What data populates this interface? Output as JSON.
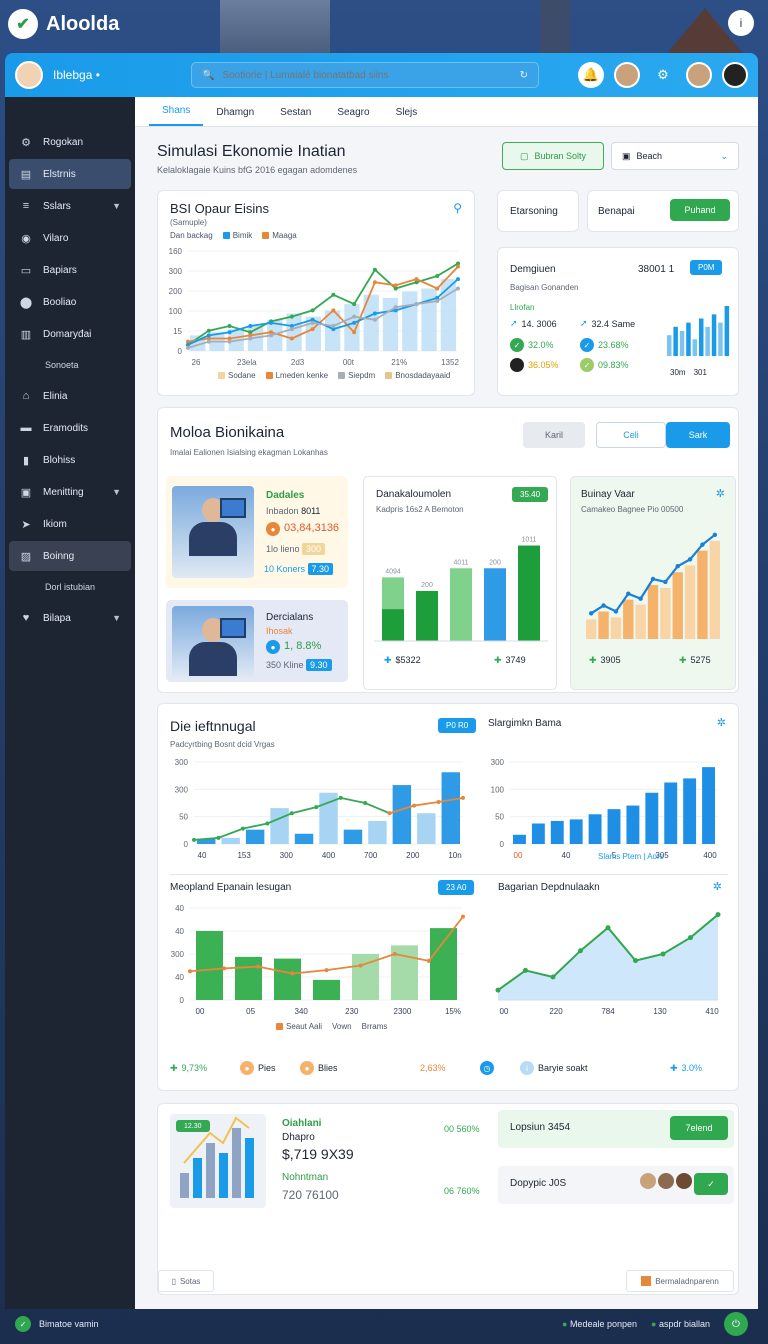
{
  "app": {
    "brand": "Aloolda",
    "help_icon": "info-icon",
    "workspace": "Iblebga"
  },
  "search": {
    "placeholder": "Sootiorie | Lumaialé bionatatbad siins"
  },
  "tabs": [
    "Shans",
    "Dhamgn",
    "Sestan",
    "Seagro",
    "Slejs"
  ],
  "sidebar": {
    "items": [
      {
        "label": "Rogokan",
        "icon": "gear-icon"
      },
      {
        "label": "Elstrnis",
        "icon": "document-icon"
      },
      {
        "label": "Sslars",
        "icon": "list-icon",
        "chevron": true
      },
      {
        "label": "Vilaro",
        "icon": "globe-icon"
      },
      {
        "label": "Bapiars",
        "icon": "folder-icon"
      },
      {
        "label": "Booliao",
        "icon": "location-icon"
      },
      {
        "label": "Domaryđai",
        "icon": "chart-icon"
      }
    ],
    "sub_1": "Sonoeta",
    "items2": [
      {
        "label": "Elinia",
        "icon": "bank-icon"
      },
      {
        "label": "Eramodits",
        "icon": "money-icon"
      },
      {
        "label": "Blohiss",
        "icon": "book-icon"
      },
      {
        "label": "Menitting",
        "icon": "monitor-icon",
        "chevron": true
      },
      {
        "label": "Ikiom",
        "icon": "send-icon"
      },
      {
        "label": "Boinng",
        "icon": "image-icon"
      }
    ],
    "sub_2": "Dorl istubian",
    "last": {
      "label": "Bilapa",
      "icon": "heart-icon",
      "chevron": true
    }
  },
  "page": {
    "title": "Simulasi Ekonomie Inatian",
    "subtitle": "Kelaloklagaie Kuins bfG 2016 egagan adomdenes"
  },
  "header_actions": {
    "green_button": "Bubran Solty",
    "select_value": "Beach"
  },
  "card1": {
    "title": "BSI Opaur Eisins",
    "sub": "(Samuple)",
    "legend_top": [
      "Dan backag",
      "Bimik",
      "Maaga"
    ],
    "legend_bottom": [
      "Sodane",
      "Lmeden kenke",
      "Siepdm",
      "Bnosdadayaaid"
    ]
  },
  "card2": {
    "label": "Etarsoning"
  },
  "card3": {
    "label": "Benapai",
    "button": "Puhand"
  },
  "card4": {
    "title": "Demgiuen",
    "value": "38001 1",
    "badge": "P0M",
    "sub": "Bagisan Gonanden",
    "sub2": "Llrofan",
    "stats": [
      "14. 3006",
      "32.4 Same",
      "32.0%",
      "23.68%",
      "36.05%",
      "09.83%"
    ],
    "foot": [
      "30m",
      "301"
    ]
  },
  "section2": {
    "title": "Moloa Bionikaina",
    "sub": "Imalai Ealionen Isialsing ekagman Lokanhas",
    "btn_grey": "Karil",
    "btn_white": "Celi",
    "btn_blue": "Sark"
  },
  "person1": {
    "name": "Dadales",
    "line1": "Inbadon",
    "line1_val": "8011",
    "value": "03,84,3136",
    "line3": "1lo lieno",
    "chip": "300",
    "line4": "10 Koners",
    "chip2": "7.30"
  },
  "person2": {
    "name": "Dercialans",
    "line1": "Ihosak",
    "value": "1, 8.8%",
    "line3": "350 Kline",
    "chip": "9.30"
  },
  "card5": {
    "title": "Danakaloumolen",
    "sub": "Kadpris 16s2 A Bemoton",
    "badge": "35.40",
    "foot1": "$5322",
    "foot2": "3749"
  },
  "card6": {
    "title": "Buinay Vaar",
    "sub": "Camakeo Bagnee Pio 00500",
    "foot1": "3905",
    "foot2": "5275"
  },
  "section3": {
    "title": "Die ieftnnugal",
    "badge": "P0 R0",
    "sub": "Padcyrtbing Bosnt dcid Vrgas",
    "right_title": "Slargimkn Bama",
    "right_legend": "Slams Ptem | Aors"
  },
  "section4": {
    "title": "Meopland Epanain lesugan",
    "badge": "23 A0",
    "legend": [
      "Seaut Aali",
      "Vown",
      "Brrams"
    ],
    "right_title": "Bagarian Depdnulaakn"
  },
  "bottom_stats": {
    "s1": "9,73%",
    "s2": "Pies",
    "s3": "Blies",
    "s4": "2,63%",
    "s5": "Baryie soakt",
    "s6": "3.0%"
  },
  "promo": {
    "title": "Oiahlani",
    "sub": "Dhapro",
    "value": "$,719 9X39",
    "label2": "Nohntman",
    "value2": "720 76100",
    "pct1": "00 560%",
    "pct2": "06 760%",
    "thumb_badge": "12.30"
  },
  "side_cards": [
    {
      "label": "Lopsiun",
      "value": "3454",
      "button": "7elend"
    },
    {
      "label": "Dopypic",
      "value": "J0S"
    }
  ],
  "bottom_left_tab": "Sotas",
  "bottom_right_tab": "Bermaladnparenn",
  "footer": {
    "left": "Bimatoe vamin",
    "right1": "Medeale ponpen",
    "right2": "aspdr biallan"
  },
  "chart_data": [
    {
      "type": "line",
      "id": "card1",
      "title": "BSI Opaur Eisins",
      "categories": [
        "26",
        "23ela",
        "2d3",
        "00t",
        "21%",
        "1352"
      ],
      "ylim": [
        0,
        320
      ],
      "yticks": [
        "0",
        "15",
        "100",
        "200",
        "300",
        "160"
      ],
      "series": [
        {
          "name": "Maaga",
          "color": "#34a853",
          "values": [
            20,
            65,
            80,
            60,
            95,
            110,
            130,
            180,
            150,
            260,
            200,
            220,
            240,
            280
          ]
        },
        {
          "name": "Dan backag",
          "color": "#e6873a",
          "values": [
            30,
            40,
            40,
            50,
            60,
            40,
            70,
            130,
            60,
            220,
            210,
            230,
            200,
            270
          ]
        },
        {
          "name": "Bimik",
          "color": "#1a9be9",
          "values": [
            20,
            50,
            60,
            80,
            90,
            80,
            100,
            70,
            90,
            120,
            130,
            150,
            170,
            230
          ]
        },
        {
          "name": "Siepdm",
          "color": "#a8adb8",
          "values": [
            10,
            30,
            30,
            40,
            50,
            70,
            90,
            80,
            110,
            100,
            140,
            150,
            160,
            200
          ]
        }
      ],
      "bars": [
        50,
        60,
        70,
        80,
        100,
        120,
        110,
        130,
        150,
        180,
        170,
        190,
        200,
        230
      ]
    },
    {
      "type": "bar",
      "id": "card4",
      "values": [
        5,
        7,
        6,
        8,
        4,
        9,
        7,
        10,
        8,
        12
      ]
    },
    {
      "type": "bar",
      "id": "card5",
      "values": [
        {
          "light": 70,
          "dark": 35,
          "label": "4094"
        },
        {
          "light": 55,
          "dark": 55,
          "label": "200"
        },
        {
          "light": 80,
          "dark": 0,
          "label": "4011"
        },
        {
          "light": 80,
          "dark": 0,
          "label": "200",
          "blue": true
        },
        {
          "light": 105,
          "dark": 105,
          "label": "1011"
        }
      ]
    },
    {
      "type": "area",
      "id": "card6",
      "values": [
        20,
        28,
        22,
        40,
        35,
        55,
        52,
        68,
        75,
        90,
        100
      ]
    },
    {
      "type": "bar",
      "id": "sec3left",
      "categories": [
        "40",
        "153",
        "300",
        "400",
        "700",
        "200",
        "10n"
      ],
      "ylim": [
        0,
        160
      ],
      "yticks": [
        "0",
        "50",
        "300",
        "300"
      ],
      "bars": [
        10,
        12,
        28,
        70,
        20,
        100,
        28,
        45,
        115,
        60,
        140
      ],
      "line": [
        8,
        12,
        30,
        40,
        60,
        72,
        90,
        80,
        60,
        75,
        82,
        90
      ]
    },
    {
      "type": "bar",
      "id": "sec3right",
      "categories": [
        "00",
        "40",
        "5",
        "305",
        "400"
      ],
      "ylim": [
        0,
        160
      ],
      "yticks": [
        "0",
        "50",
        "100",
        "300"
      ],
      "bars": [
        18,
        40,
        45,
        48,
        58,
        68,
        75,
        100,
        120,
        128,
        150
      ]
    },
    {
      "type": "bar",
      "id": "sec4left",
      "categories": [
        "00",
        "05",
        "340",
        "230",
        "2300",
        "15%"
      ],
      "ylim": [
        0,
        160
      ],
      "yticks": [
        "0",
        "40",
        "300",
        "40",
        "40"
      ],
      "bars": [
        120,
        75,
        72,
        35,
        80,
        95,
        125
      ],
      "bars_light": [
        0,
        0,
        0,
        0,
        0,
        95,
        0
      ],
      "line": [
        50,
        55,
        58,
        46,
        52,
        60,
        80,
        68,
        145
      ]
    },
    {
      "type": "area",
      "id": "sec4right",
      "categories": [
        "00",
        "220",
        "784",
        "130",
        "410"
      ],
      "values": [
        15,
        45,
        35,
        75,
        110,
        60,
        70,
        95,
        130
      ]
    },
    {
      "type": "bar",
      "id": "promo",
      "values": [
        25,
        40,
        55,
        45,
        70,
        60
      ]
    }
  ]
}
